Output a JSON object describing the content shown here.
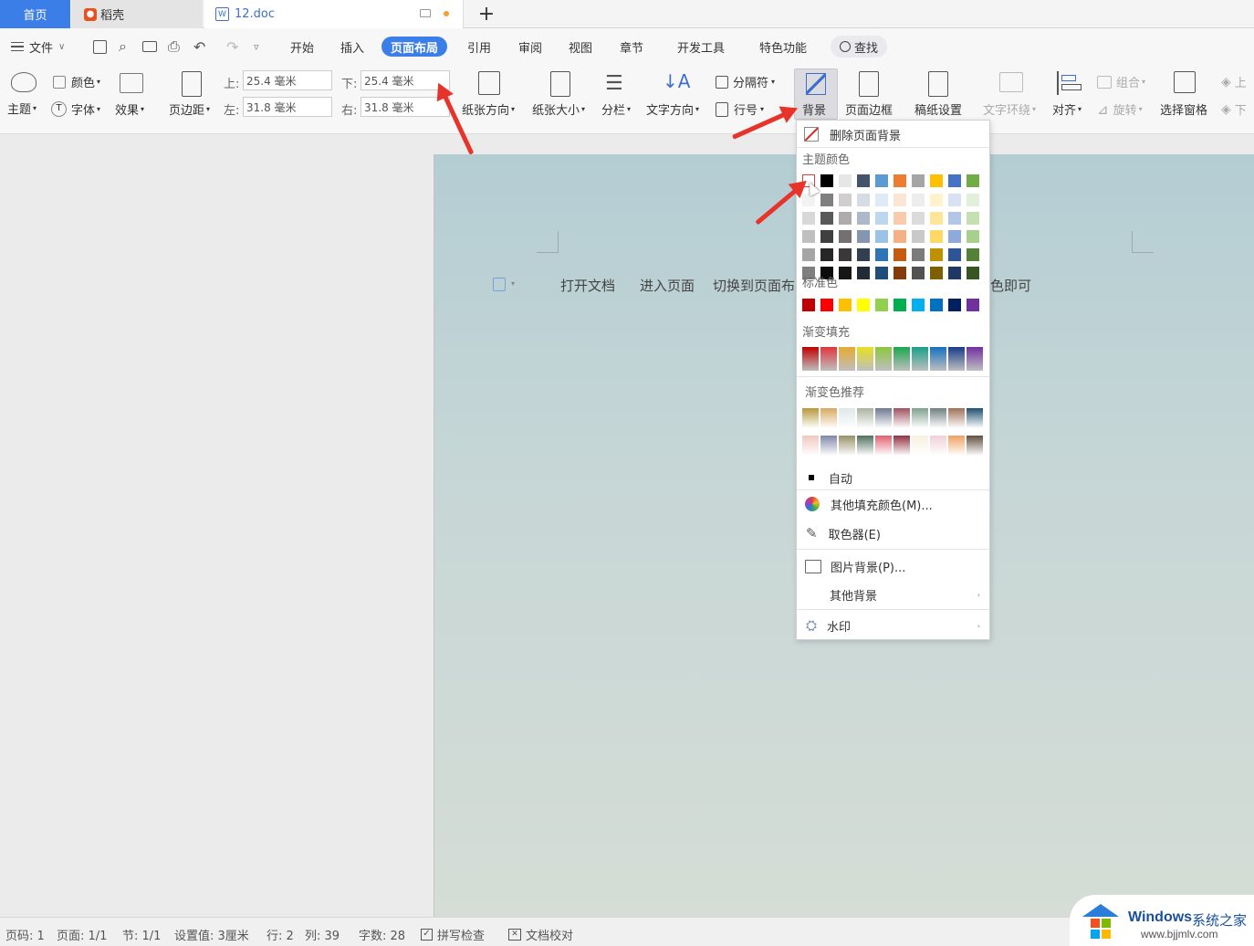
{
  "tabs": {
    "home": "首页",
    "daoke": "稻壳",
    "doc": "12.doc",
    "plus": "+"
  },
  "menubar": {
    "file": "文件",
    "items": [
      "开始",
      "插入",
      "页面布局",
      "引用",
      "审阅",
      "视图",
      "章节",
      "开发工具",
      "特色功能"
    ],
    "active": "页面布局",
    "search": "查找"
  },
  "ribbon": {
    "theme": "主题",
    "colors": "颜色",
    "fonts": "字体",
    "effects": "效果",
    "margins": "页边距",
    "top_label": "上:",
    "top_value": "25.4 毫米",
    "bottom_label": "下:",
    "bottom_value": "25.4 毫米",
    "left_label": "左:",
    "left_value": "31.8 毫米",
    "right_label": "右:",
    "right_value": "31.8 毫米",
    "orientation": "纸张方向",
    "size": "纸张大小",
    "columns": "分栏",
    "text_direction": "文字方向",
    "separator": "分隔符",
    "line_number": "行号",
    "background": "背景",
    "page_border": "页面边框",
    "manuscript": "稿纸设置",
    "text_wrap": "文字环绕",
    "align": "对齐",
    "group": "组合",
    "rotate": "旋转",
    "selection_pane": "选择窗格",
    "up": "上",
    "down": "下"
  },
  "document": {
    "line": [
      "打开文档",
      "进入页面",
      "切换到页面布",
      "色即可"
    ]
  },
  "bg_menu": {
    "delete_bg": "删除页面背景",
    "theme_colors_title": "主题颜色",
    "theme_top": [
      "#ffffff",
      "#000000",
      "#e7e6e6",
      "#44546a",
      "#5b9bd5",
      "#ed7d31",
      "#a5a5a5",
      "#ffc000",
      "#4472c4",
      "#70ad47"
    ],
    "theme_shades": [
      [
        "#f2f2f2",
        "#7f7f7f",
        "#d0cece",
        "#d6dce4",
        "#deebf6",
        "#fbe5d5",
        "#ededed",
        "#fff2cc",
        "#d9e2f3",
        "#e2efd9"
      ],
      [
        "#d8d8d8",
        "#595959",
        "#aeabab",
        "#adb9ca",
        "#bdd7ee",
        "#f7cbac",
        "#dbdbdb",
        "#fee599",
        "#b4c6e7",
        "#c5e0b3"
      ],
      [
        "#bfbfbf",
        "#3f3f3f",
        "#757070",
        "#8496b0",
        "#9cc3e5",
        "#f4b183",
        "#c9c9c9",
        "#ffd965",
        "#8eaadb",
        "#a8d08d"
      ],
      [
        "#a5a5a5",
        "#262626",
        "#3a3838",
        "#323f4f",
        "#2e75b5",
        "#c55a11",
        "#7b7b7b",
        "#bf9000",
        "#2f5496",
        "#538135"
      ],
      [
        "#7f7f7f",
        "#0c0c0c",
        "#171616",
        "#222a35",
        "#1e4e79",
        "#833c0b",
        "#525252",
        "#7f6000",
        "#1f3864",
        "#375623"
      ]
    ],
    "standard_title": "标准色",
    "standard": [
      "#c00000",
      "#ff0000",
      "#ffc000",
      "#ffff00",
      "#92d050",
      "#00b050",
      "#00b0f0",
      "#0070c0",
      "#002060",
      "#7030a0"
    ],
    "gradient_title": "渐变填充",
    "gradient": [
      "#c00000",
      "#e0353b",
      "#e8a930",
      "#e8e020",
      "#8cc63e",
      "#1aa84c",
      "#18a088",
      "#1470c0",
      "#1a3a8c",
      "#7030a0"
    ],
    "recommend_title": "渐变色推荐",
    "recommend_row1": [
      "#b8983c",
      "#d8a860",
      "#dde8e8",
      "#a8b4a0",
      "#707890",
      "#a05060",
      "#80a090",
      "#708080",
      "#a07058",
      "#205070"
    ],
    "recommend_row2": [
      "#f0c8c0",
      "#8088a8",
      "#989068",
      "#507060",
      "#e06070",
      "#903040",
      "#f8f0e0",
      "#f0d0d8",
      "#f0a060",
      "#605040"
    ],
    "auto": "自动",
    "more_colors": "其他填充颜色(M)...",
    "picker": "取色器(E)",
    "picture_bg": "图片背景(P)...",
    "other_bg": "其他背景",
    "watermark": "水印"
  },
  "status": {
    "page_num": "页码: 1",
    "pages": "页面: 1/1",
    "section": "节: 1/1",
    "setting": "设置值: 3厘米",
    "row": "行: 2",
    "col": "列: 39",
    "words": "字数: 28",
    "spell": "拼写检查",
    "proof": "文档校对"
  },
  "watermark": {
    "brand": "Windows",
    "brand_cn": "系统之家",
    "url": "www.bjjmlv.com"
  },
  "colors": {
    "accent": "#3c7ee8",
    "arrow": "#e8332a"
  }
}
